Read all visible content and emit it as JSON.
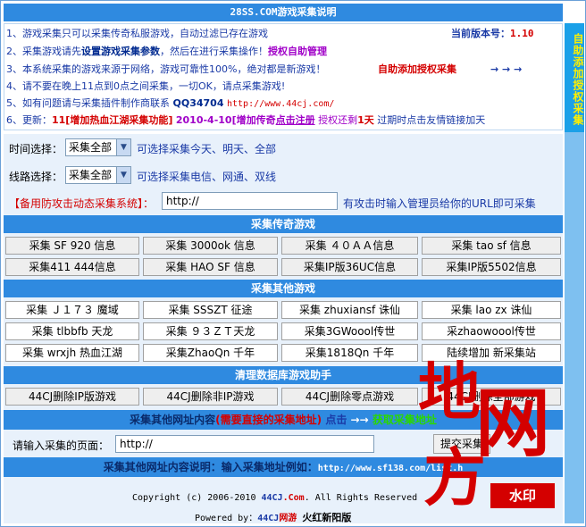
{
  "title": "28SS.COM游戏采集说明",
  "side_label": "自助添加授权采集",
  "info": {
    "l1": "1、游戏采集只可以采集传奇私服游戏，自动过滤已存在游戏",
    "version_label": "当前版本号：",
    "version": "1.10",
    "l2a": "2、采集游戏请先",
    "l2b": "设置游戏采集参数",
    "l2c": "，然后在进行采集操作！",
    "l2d": "授权自助管理",
    "l3": "3、本系统采集的游戏来源于网络，游戏可靠性100%，绝对都是新游戏！",
    "l3_red": "自助添加授权采集",
    "arrows": "→ → →",
    "l4": "4、请不要在晚上11点到0点之间采集，一切OK，请点采集游戏!",
    "l5a": "5、如有问题请与采集插件制作商联系",
    "qq": "QQ34704",
    "url": "http://www.44cj.com/",
    "l6a": "6、更新：",
    "l6b": "11[增加",
    "l6c": "热血江湖",
    "l6d": "采集功能]",
    "l6e": "2010-4-10[增加传奇",
    "l6f": "点击注册",
    "l6g": "授权还剩",
    "l6h": "1天",
    "l6i": "过期时点击友情链接加天"
  },
  "settings": {
    "time_label": "时间选择：",
    "time_value": "采集全部",
    "time_hint": "可选择采集今天、明天、全部",
    "line_label": "线路选择：",
    "line_value": "采集全部",
    "line_hint": "可选择采集电信、网通、双线",
    "backup_label": "【备用防攻击动态采集系统】：",
    "backup_value": "http://",
    "backup_hint": "有攻击时输入管理员给你的URL即可采集"
  },
  "sections": {
    "legend": "采集传奇游戏",
    "other": "采集其他游戏",
    "db": "清理数据库游戏助手"
  },
  "legend_buttons": [
    "采集 SF 920 信息",
    "采集 3000ok 信息",
    "采集 ４０ＡＡ信息",
    "采集  tao sf 信息",
    "采集411 444信息",
    "采集 HAO SF 信息",
    "采集IP版36UC信息",
    "采集IP版5502信息"
  ],
  "other_buttons": [
    "采集 Ｊ１７３ 魔域",
    "采集 SSSZT 征途",
    "采集 zhuxiansf 诛仙",
    "采集 lao zx 诛仙",
    "采集  tlbbfb 天龙",
    "采集 ９３ＺＴ天龙",
    "采集3GWoool传世",
    "采zhaowoool传世",
    "采集 wrxjh 热血江湖",
    "采集ZhaoQn 千年",
    "采集1818Qn 千年",
    "陆续增加 新采集站"
  ],
  "db_buttons": [
    "44CJ删除IP版游戏",
    "44CJ删除非IP游戏",
    "44CJ删除零点游戏",
    "44CJ删除全部游戏"
  ],
  "other_url": {
    "head_a": "采集其他网址内容",
    "head_b": "(需要直接的采集地址)",
    "head_c": "点击",
    "head_arrow": "→→",
    "head_d": "获取采集地址",
    "input_label": "请输入采集的页面：",
    "input_value": "http://",
    "submit": "提交采集",
    "desc": "采集其他网址内容说明：输入采集地址例如：",
    "desc_url": "http://www.sf138.com/list.h"
  },
  "footer": {
    "copyright_a": "Copyright (c) 2006-2010 ",
    "copyright_b": "44CJ",
    "copyright_c": ".Com",
    "copyright_d": ". All Rights Reserved",
    "powered_a": "Powered by：",
    "powered_b": "44CJ",
    "powered_c": "网游",
    "powered_d": "火红新阳版"
  },
  "watermark": {
    "glyph_top": "地",
    "glyph_mid": "网",
    "glyph_bottom": "方",
    "badge": "水印"
  },
  "colors": {
    "header_blue": "#2f8ae0",
    "accent_red": "#d40000",
    "link_blue": "#1a3aa6",
    "side_yellow": "#ffef00"
  }
}
